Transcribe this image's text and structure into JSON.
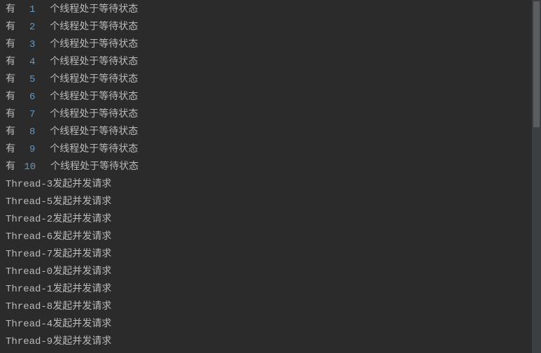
{
  "console": {
    "waiting_lines": [
      {
        "prefix": "有 ",
        "number": "1",
        "suffix": "  个线程处于等待状态"
      },
      {
        "prefix": "有 ",
        "number": "2",
        "suffix": "  个线程处于等待状态"
      },
      {
        "prefix": "有 ",
        "number": "3",
        "suffix": "  个线程处于等待状态"
      },
      {
        "prefix": "有 ",
        "number": "4",
        "suffix": "  个线程处于等待状态"
      },
      {
        "prefix": "有 ",
        "number": "5",
        "suffix": "  个线程处于等待状态"
      },
      {
        "prefix": "有 ",
        "number": "6",
        "suffix": "  个线程处于等待状态"
      },
      {
        "prefix": "有 ",
        "number": "7",
        "suffix": "  个线程处于等待状态"
      },
      {
        "prefix": "有 ",
        "number": "8",
        "suffix": "  个线程处于等待状态"
      },
      {
        "prefix": "有 ",
        "number": "9",
        "suffix": "  个线程处于等待状态"
      },
      {
        "prefix": "有 ",
        "number": "10",
        "suffix": "  个线程处于等待状态"
      }
    ],
    "thread_lines": [
      "Thread-3发起并发请求",
      "Thread-5发起并发请求",
      "Thread-2发起并发请求",
      "Thread-6发起并发请求",
      "Thread-7发起并发请求",
      "Thread-0发起并发请求",
      "Thread-1发起并发请求",
      "Thread-8发起并发请求",
      "Thread-4发起并发请求",
      "Thread-9发起并发请求"
    ]
  }
}
